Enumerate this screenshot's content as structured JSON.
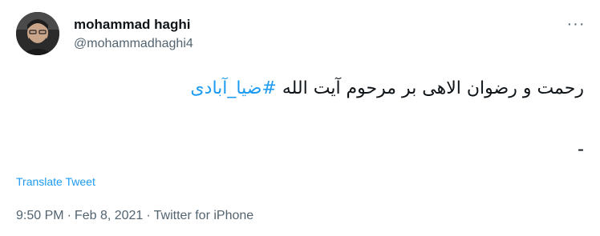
{
  "user": {
    "display_name": "mohammad haghi",
    "handle": "@mohammadhaghi4",
    "avatar": "profile-photo"
  },
  "tweet": {
    "text_main": "رحمت و رضوان الاهی بر مرحوم آیت الله ",
    "hashtag": "#ضیا_آبادی",
    "text_second_line": "-",
    "translate_label": "Translate Tweet"
  },
  "meta": {
    "time": "9:50 PM",
    "date": "Feb 8, 2021",
    "separator": "·",
    "source": "Twitter for iPhone"
  },
  "icons": {
    "more": "more-options-icon"
  },
  "colors": {
    "link": "#1d9bf0",
    "text": "#0f1419",
    "secondary": "#536471"
  }
}
